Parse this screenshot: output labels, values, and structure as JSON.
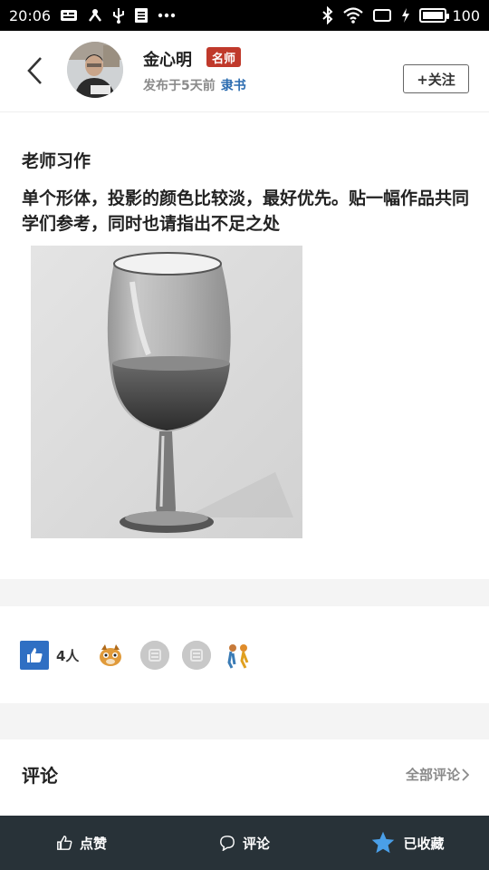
{
  "status_bar": {
    "time": "20:06",
    "battery": "100",
    "left_icons": [
      "gallery-icon",
      "network-tree-icon",
      "usb-icon",
      "document-icon",
      "more-dots-icon"
    ],
    "right_icons": [
      "bluetooth-icon",
      "wifi-icon",
      "screen-icon",
      "charging-icon",
      "battery-icon"
    ]
  },
  "header": {
    "author_name": "金心明",
    "badge": "名师",
    "published": "发布于5天前",
    "category": "隶书",
    "follow_label": "+关注"
  },
  "post": {
    "title": "老师习作",
    "body": "单个形体，投影的颜色比较淡，最好优先。贴一幅作品共同学们参考，同时也请指出不足之处"
  },
  "likes": {
    "count": "4人"
  },
  "comments": {
    "title": "评论",
    "all_label": "全部评论"
  },
  "bottom_bar": {
    "like_label": "点赞",
    "comment_label": "评论",
    "favorite_label": "已收藏"
  },
  "colors": {
    "accent_blue": "#2f6fc3",
    "badge_red": "#c0392b",
    "bottom_bar_bg": "#283238",
    "favorite_star": "#4a9fe8"
  }
}
